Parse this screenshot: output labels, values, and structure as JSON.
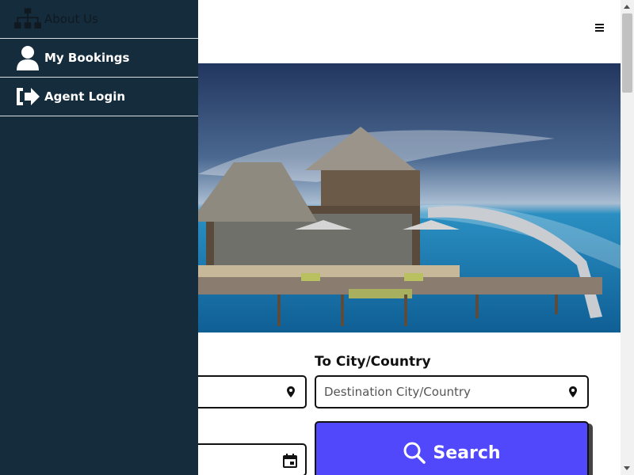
{
  "sidebar": {
    "items": [
      {
        "label": "About Us",
        "icon": "sitemap-icon"
      },
      {
        "label": "My Bookings",
        "icon": "user-icon"
      },
      {
        "label": "Agent Login",
        "icon": "sign-in-icon"
      }
    ]
  },
  "carousel": {
    "slides": 2,
    "active_index": 0
  },
  "search_form": {
    "to_label": "To City/Country",
    "destination_placeholder": "Destination City/Country",
    "search_label": "Search"
  },
  "colors": {
    "sidebar_bg": "#152c3d",
    "search_button": "#5148fb"
  }
}
